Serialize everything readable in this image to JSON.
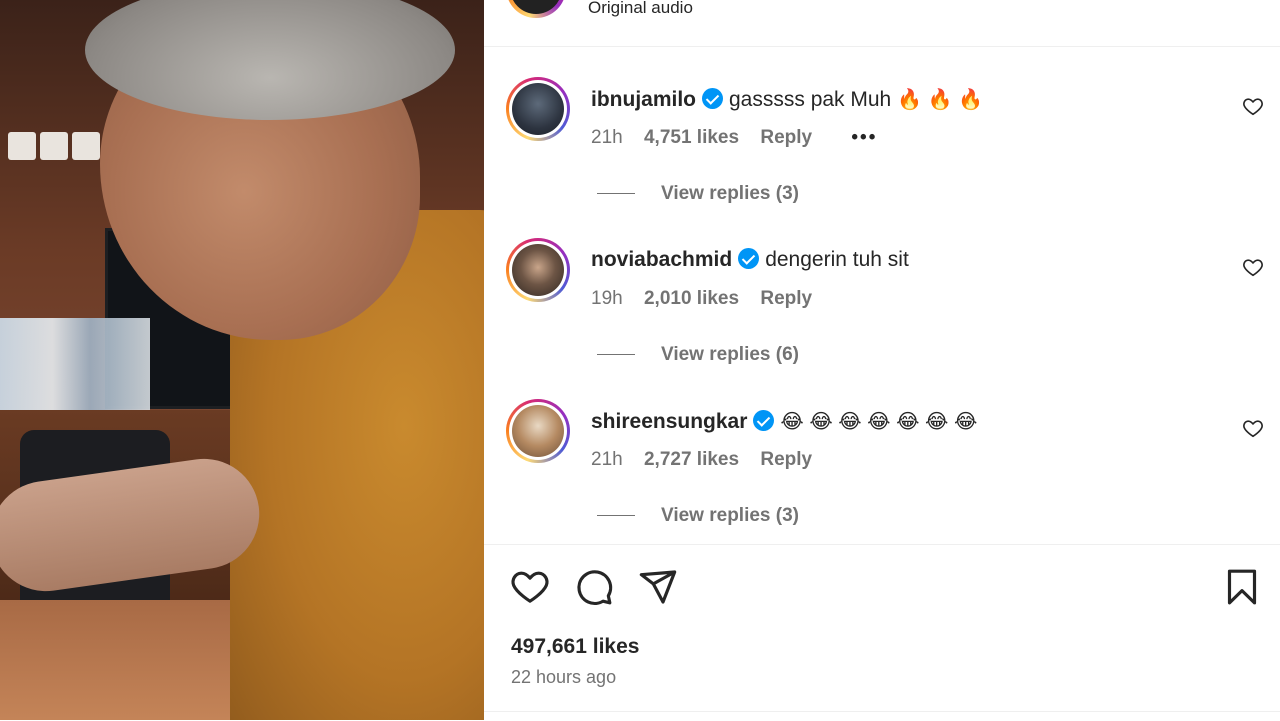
{
  "post": {
    "audio_label": "Original audio",
    "likes_label": "497,661 likes",
    "time_ago": "22 hours ago"
  },
  "comments": [
    {
      "username": "ibnujamilo",
      "verified": true,
      "text": "gasssss pak Muh",
      "emojis": "🔥 🔥 🔥",
      "time": "21h",
      "likes": "4,751 likes",
      "reply_label": "Reply",
      "more": "•••",
      "view_replies": "View replies (3)"
    },
    {
      "username": "noviabachmid",
      "verified": true,
      "text": "dengerin tuh sit",
      "emojis": "",
      "time": "19h",
      "likes": "2,010 likes",
      "reply_label": "Reply",
      "view_replies": "View replies (6)"
    },
    {
      "username": "shireensungkar",
      "verified": true,
      "text": "",
      "emojis": "😂 😂 😂 😂 😂 😂 😂",
      "time": "21h",
      "likes": "2,727 likes",
      "reply_label": "Reply",
      "view_replies": "View replies (3)"
    }
  ],
  "icons": {
    "like": "heart-icon",
    "comment": "comment-icon",
    "share": "paper-plane-icon",
    "save": "bookmark-icon",
    "verified": "verified-badge-icon",
    "comment_like": "heart-icon"
  },
  "colors": {
    "verified": "#0095f6",
    "text": "#262626",
    "secondary": "#737373",
    "divider": "#efefef"
  }
}
